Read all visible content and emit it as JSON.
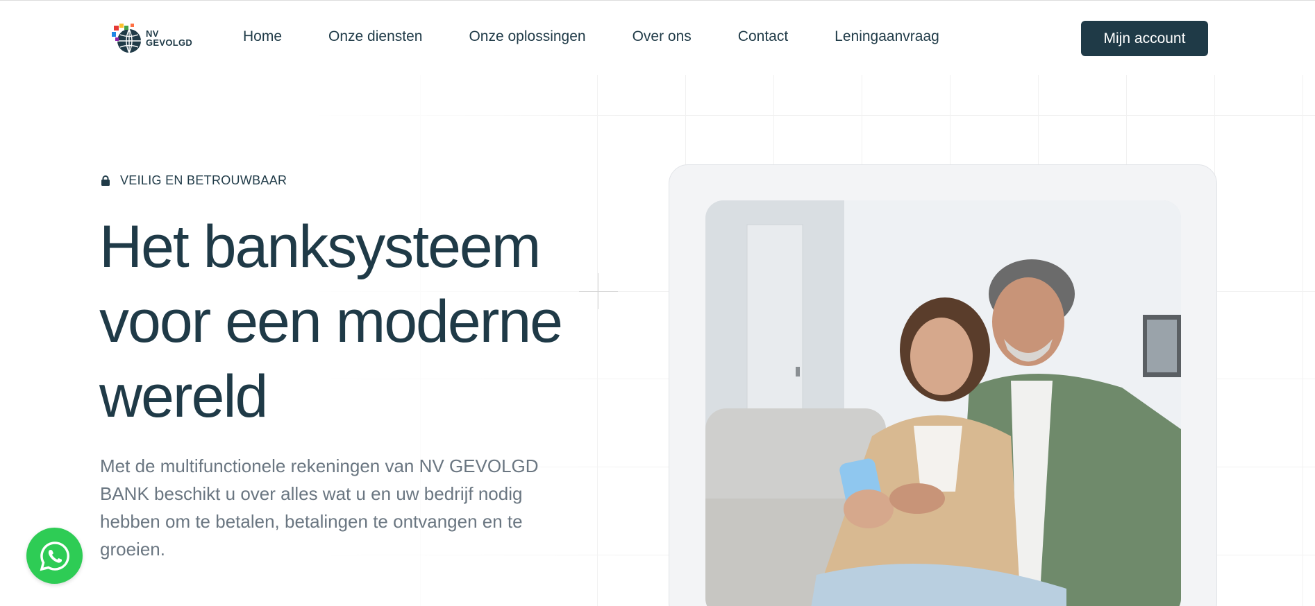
{
  "header": {
    "logo_alt": "NV GEVOLGD",
    "logo_line1": "NV",
    "logo_line2": "GEVOLGD",
    "nav": [
      "Home",
      "Onze diensten",
      "Onze oplossingen",
      "Over ons",
      "Contact",
      "Leningaanvraag"
    ],
    "cta_label": "Mijn account"
  },
  "hero": {
    "badge": "VEILIG EN BETROUWBAAR",
    "title_line1": "Het banksysteem",
    "title_line2": "voor een moderne",
    "title_line3": "wereld",
    "subtitle": "Met de multifunctionele rekeningen van NV GEVOLGD BANK beschikt u over alles wat u en uw bedrijf nodig hebben om te betalen, betalingen te ontvangen en te groeien."
  },
  "icons": {
    "badge": "lock-icon",
    "chat": "whatsapp-icon"
  },
  "colors": {
    "primary": "#1f3a47",
    "muted_text": "#6a7681",
    "whatsapp": "#2ecc55",
    "card_bg": "#f3f4f6"
  }
}
